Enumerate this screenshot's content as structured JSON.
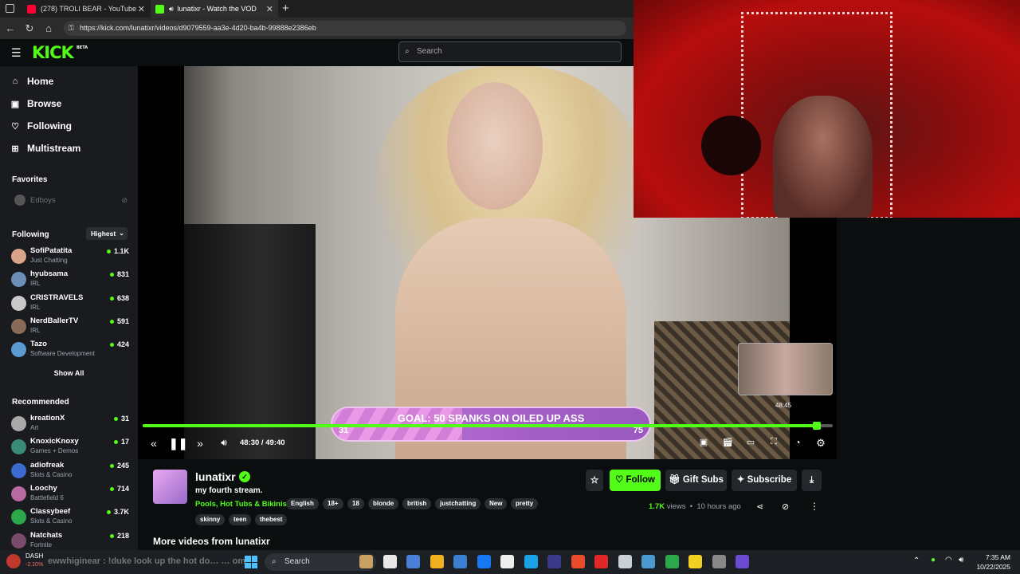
{
  "browser": {
    "tabs": [
      {
        "label": "(278) TROLI BEAR - YouTube",
        "favicon_color": "#ff0033"
      },
      {
        "label": "lunatixr - Watch the VOD on",
        "favicon_color": "#53fc18"
      }
    ],
    "url": "https://kick.com/lunatixr/videos/d9079559-aa3e-4d20-ba4b-99888e2386eb"
  },
  "header": {
    "logo": "KICK",
    "logo_badge": "BETA",
    "search_placeholder": "Search"
  },
  "sidebar": {
    "nav": [
      {
        "label": "Home",
        "icon": "home-icon",
        "glyph": "⌂"
      },
      {
        "label": "Browse",
        "icon": "browse-icon",
        "glyph": "▣"
      },
      {
        "label": "Following",
        "icon": "heart-icon",
        "glyph": "♡"
      },
      {
        "label": "Multistream",
        "icon": "grid-icon",
        "glyph": "⊞"
      }
    ],
    "favorites_title": "Favorites",
    "favorites": [
      {
        "name": "Edboys"
      }
    ],
    "following_title": "Following",
    "sort_label": "Highest",
    "following": [
      {
        "name": "SofiPatatita",
        "category": "Just Chatting",
        "viewers": "1.1K",
        "color": "#d9a38a"
      },
      {
        "name": "hyubsama",
        "category": "IRL",
        "viewers": "831",
        "color": "#6b8fb8"
      },
      {
        "name": "CRISTRAVELS",
        "category": "IRL",
        "viewers": "638",
        "color": "#c9c9c9"
      },
      {
        "name": "NerdBallerTV",
        "category": "IRL",
        "viewers": "591",
        "color": "#8a6b5a"
      },
      {
        "name": "Tazo",
        "category": "Software Development",
        "viewers": "424",
        "color": "#5a9ad0"
      }
    ],
    "show_all": "Show All",
    "recommended_title": "Recommended",
    "recommended": [
      {
        "name": "kreationX",
        "category": "Art",
        "viewers": "31",
        "color": "#aaa"
      },
      {
        "name": "KnoxicKnoxy",
        "category": "Games + Demos",
        "viewers": "17",
        "color": "#3a8a7a"
      },
      {
        "name": "adiofreak",
        "category": "Slots & Casino",
        "viewers": "245",
        "color": "#3b6ad0"
      },
      {
        "name": "Loochy",
        "category": "Battlefield 6",
        "viewers": "714",
        "color": "#b86aa0"
      },
      {
        "name": "Classybeef",
        "category": "Slots & Casino",
        "viewers": "3.7K",
        "color": "#2aa84a"
      },
      {
        "name": "Natchats",
        "category": "Fortnite",
        "viewers": "218",
        "color": "#7a4a6a"
      }
    ]
  },
  "player": {
    "goal_label": "GOAL: 50 SPANKS ON OILED UP ASS",
    "goal_current": "31",
    "goal_target": "75",
    "goal_fraction": 0.41,
    "preview_time": "48:45",
    "time": "48:30 / 49:40",
    "progress_fraction": 0.977
  },
  "channel": {
    "name": "lunatixr",
    "title": "my fourth stream.",
    "category": "Pools, Hot Tubs & Bikinis",
    "tags_row1": [
      "English",
      "18+",
      "18",
      "blonde",
      "british",
      "justchatting",
      "New",
      "pretty"
    ],
    "tags_row2": [
      "skinny",
      "teen",
      "thebest"
    ],
    "follow_label": "Follow",
    "gift_label": "Gift Subs",
    "subscribe_label": "Subscribe",
    "views": "1.7K",
    "views_suffix": "views",
    "time_ago": "10 hours ago"
  },
  "more_videos": "More videos from lunatixr",
  "taskbar": {
    "ticker": "ewwhiginear : !duke look up the hot do… … om ikea … (partial)",
    "dash_label": "DASH",
    "dash_change": "-2.10%",
    "search_label": "Search",
    "time": "7:35 AM",
    "date": "10/22/2025"
  }
}
